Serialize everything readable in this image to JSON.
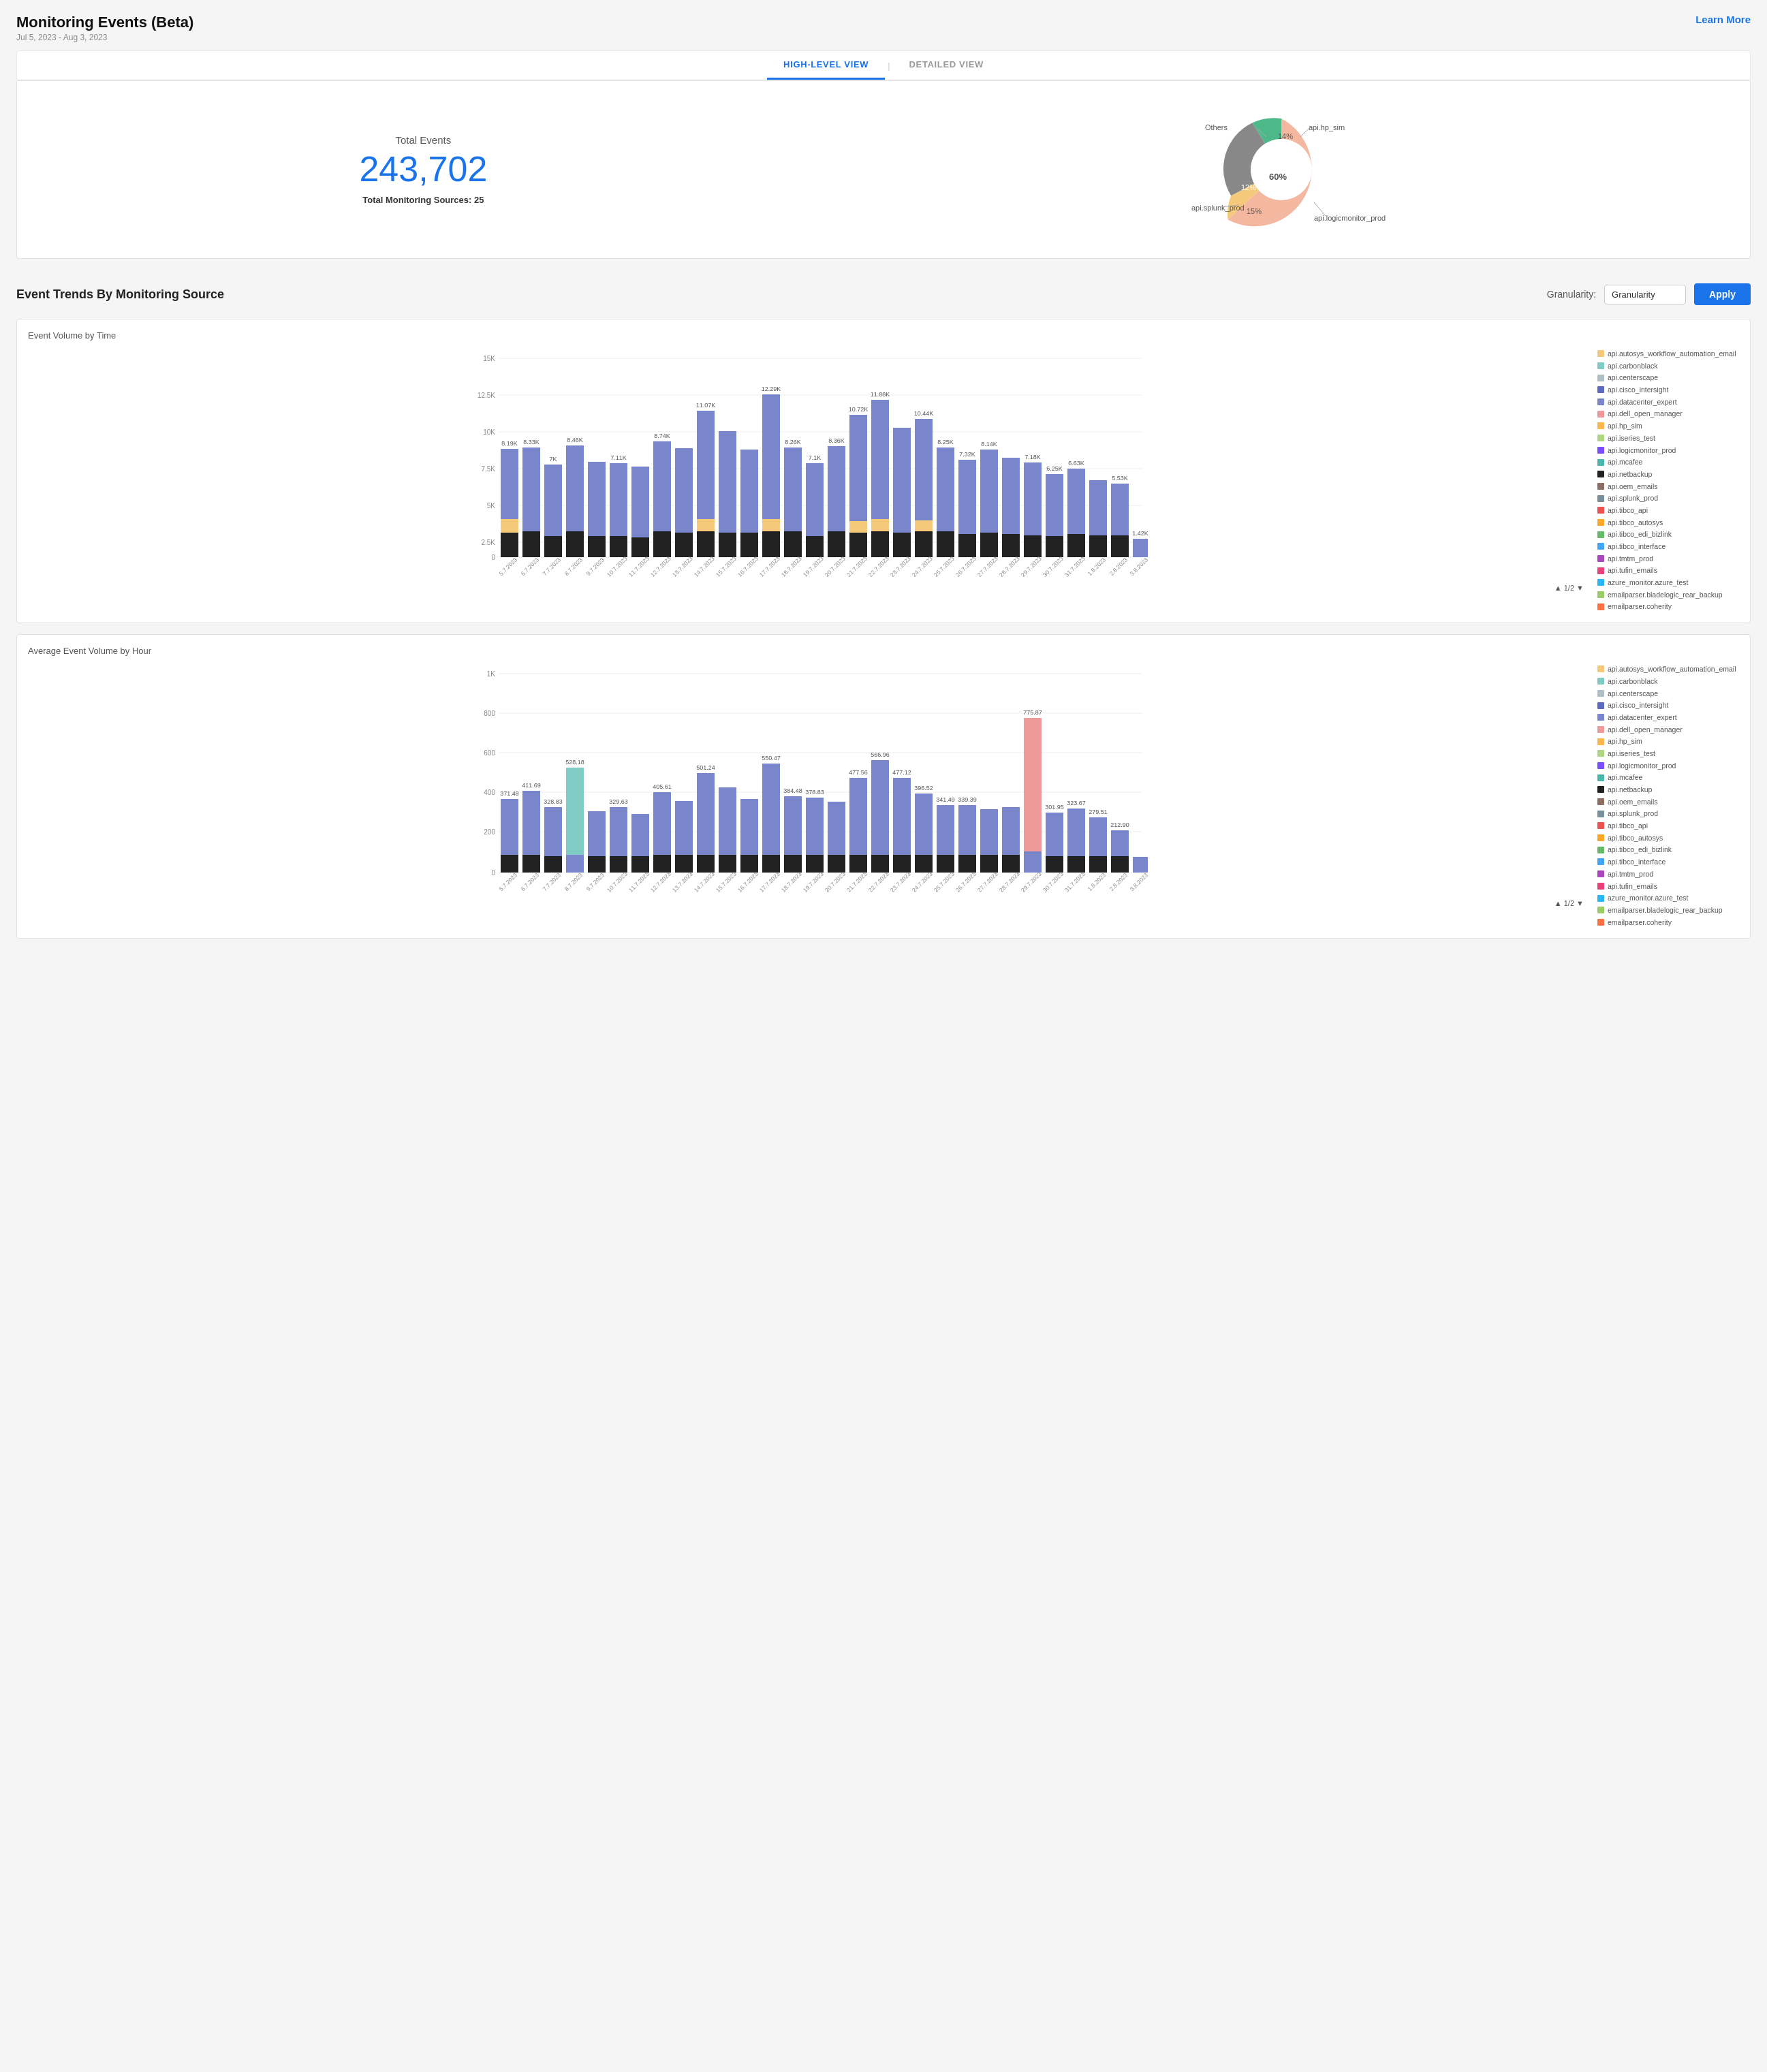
{
  "header": {
    "title": "Monitoring Events (Beta)",
    "date_range": "Jul 5, 2023 - Aug 3, 2023",
    "learn_more": "Learn More"
  },
  "tabs": [
    {
      "label": "HIGH-LEVEL VIEW",
      "active": true
    },
    {
      "label": "DETAILED VIEW",
      "active": false
    }
  ],
  "summary": {
    "total_events_label": "Total Events",
    "total_events_number": "243,702",
    "total_sources_label": "Total Monitoring Sources:",
    "total_sources_value": "25"
  },
  "donut": {
    "segments": [
      {
        "label": "api.logicmonitor_prod",
        "value": 60,
        "color": "#f4b8a0"
      },
      {
        "label": "api.hp_sim",
        "value": 14,
        "color": "#f4c97a"
      },
      {
        "label": "Others",
        "value": 12,
        "color": "#888"
      },
      {
        "label": "api.splunk_prod",
        "value": 15,
        "color": "#4db88a"
      }
    ]
  },
  "trends_section": {
    "title": "Event Trends By Monitoring Source",
    "granularity_label": "Granularity:",
    "granularity_placeholder": "Granularity",
    "apply_label": "Apply"
  },
  "chart1": {
    "title": "Event Volume by Time",
    "y_max": "15K",
    "y_ticks": [
      "15K",
      "12.5K",
      "10K",
      "7.5K",
      "5K",
      "2.5K",
      "0"
    ],
    "bars": [
      {
        "date": "5.7.2023",
        "total": "8.19K",
        "value": 8190
      },
      {
        "date": "6.7.2023",
        "total": "8.33K",
        "value": 8330
      },
      {
        "date": "7.7.2023",
        "total": "7K",
        "value": 7000
      },
      {
        "date": "8.7.2023",
        "total": "8.46K",
        "value": 8460
      },
      {
        "date": "9.7.2023",
        "total": "",
        "value": 7200
      },
      {
        "date": "10.7.2023",
        "total": "7.11K",
        "value": 7110
      },
      {
        "date": "11.7.2023",
        "total": "",
        "value": 6800
      },
      {
        "date": "12.7.2023",
        "total": "8.74K",
        "value": 8740
      },
      {
        "date": "13.7.2023",
        "total": "",
        "value": 8200
      },
      {
        "date": "14.7.2023",
        "total": "11.07K",
        "value": 11070
      },
      {
        "date": "15.7.2023",
        "total": "",
        "value": 9500
      },
      {
        "date": "16.7.2023",
        "total": "",
        "value": 8100
      },
      {
        "date": "17.7.2023",
        "total": "12.29K",
        "value": 12290
      },
      {
        "date": "18.7.2023",
        "total": "8.26K",
        "value": 8260
      },
      {
        "date": "19.7.2023",
        "total": "7.1K",
        "value": 7100
      },
      {
        "date": "20.7.2023",
        "total": "8.36K",
        "value": 8360
      },
      {
        "date": "21.7.2023",
        "total": "10.72K",
        "value": 10720
      },
      {
        "date": "22.7.2023",
        "total": "11.88K",
        "value": 11880
      },
      {
        "date": "23.7.2023",
        "total": "",
        "value": 9800
      },
      {
        "date": "24.7.2023",
        "total": "10.44K",
        "value": 10440
      },
      {
        "date": "25.7.2023",
        "total": "8.25K",
        "value": 8250
      },
      {
        "date": "26.7.2023",
        "total": "7.32K",
        "value": 7320
      },
      {
        "date": "27.7.2023",
        "total": "8.14K",
        "value": 8140
      },
      {
        "date": "28.7.2023",
        "total": "",
        "value": 7500
      },
      {
        "date": "29.7.2023",
        "total": "7.18K",
        "value": 7180
      },
      {
        "date": "30.7.2023",
        "total": "6.25K",
        "value": 6250
      },
      {
        "date": "31.7.2023",
        "total": "6.63K",
        "value": 6630
      },
      {
        "date": "1.8.2023",
        "total": "",
        "value": 5800
      },
      {
        "date": "2.8.2023",
        "total": "5.53K",
        "value": 5530
      },
      {
        "date": "3.8.2023",
        "total": "1.42K",
        "value": 1420
      }
    ],
    "pagination": "▲ 1/2 ▼"
  },
  "chart2": {
    "title": "Average Event Volume by Hour",
    "y_max": "1K",
    "y_ticks": [
      "1K",
      "800",
      "600",
      "400",
      "200",
      "0"
    ],
    "bars": [
      {
        "date": "5.7.2023",
        "total": "371.48",
        "value": 371
      },
      {
        "date": "6.7.2023",
        "total": "411.69",
        "value": 412
      },
      {
        "date": "7.7.2023",
        "total": "328.83",
        "value": 329
      },
      {
        "date": "8.7.2023",
        "total": "528.18",
        "value": 528
      },
      {
        "date": "9.7.2023",
        "total": "",
        "value": 310
      },
      {
        "date": "10.7.2023",
        "total": "329.63",
        "value": 330
      },
      {
        "date": "11.7.2023",
        "total": "",
        "value": 295
      },
      {
        "date": "12.7.2023",
        "total": "405.61",
        "value": 406
      },
      {
        "date": "13.7.2023",
        "total": "",
        "value": 360
      },
      {
        "date": "14.7.2023",
        "total": "501.24",
        "value": 501
      },
      {
        "date": "15.7.2023",
        "total": "",
        "value": 430
      },
      {
        "date": "16.7.2023",
        "total": "",
        "value": 370
      },
      {
        "date": "17.7.2023",
        "total": "550.47",
        "value": 550
      },
      {
        "date": "18.7.2023",
        "total": "384.48",
        "value": 384
      },
      {
        "date": "19.7.2023",
        "total": "378.83",
        "value": 379
      },
      {
        "date": "20.7.2023",
        "total": "",
        "value": 355
      },
      {
        "date": "21.7.2023",
        "total": "477.56",
        "value": 478
      },
      {
        "date": "22.7.2023",
        "total": "566.96",
        "value": 567
      },
      {
        "date": "23.7.2023",
        "total": "477.12",
        "value": 477
      },
      {
        "date": "24.7.2023",
        "total": "396.52",
        "value": 397
      },
      {
        "date": "25.7.2023",
        "total": "341.49",
        "value": 341
      },
      {
        "date": "26.7.2023",
        "total": "339.39",
        "value": 339
      },
      {
        "date": "27.7.2023",
        "total": "",
        "value": 320
      },
      {
        "date": "28.7.2023",
        "total": "",
        "value": 330
      },
      {
        "date": "29.7.2023",
        "total": "775.87",
        "value": 776
      },
      {
        "date": "30.7.2023",
        "total": "301.95",
        "value": 302
      },
      {
        "date": "31.7.2023",
        "total": "323.67",
        "value": 324
      },
      {
        "date": "1.8.2023",
        "total": "279.51",
        "value": 280
      },
      {
        "date": "2.8.2023",
        "total": "212.90",
        "value": 213
      },
      {
        "date": "3.8.2023",
        "total": "",
        "value": 80
      }
    ],
    "pagination": "▲ 1/2 ▼"
  },
  "legend_items": [
    {
      "label": "api.autosys_workflow_automation_email",
      "color": "#f4c97a"
    },
    {
      "label": "api.carbonblack",
      "color": "#80cbc4"
    },
    {
      "label": "api.centerscape",
      "color": "#b0bec5"
    },
    {
      "label": "api.cisco_intersight",
      "color": "#5c6bc0"
    },
    {
      "label": "api.datacenter_expert",
      "color": "#7986cb"
    },
    {
      "label": "api.dell_open_manager",
      "color": "#ef9a9a"
    },
    {
      "label": "api.hp_sim",
      "color": "#ffb74d"
    },
    {
      "label": "api.iseries_test",
      "color": "#aed581"
    },
    {
      "label": "api.logicmonitor_prod",
      "color": "#7c4dff"
    },
    {
      "label": "api.mcafee",
      "color": "#4db6ac"
    },
    {
      "label": "api.netbackup",
      "color": "#212121"
    },
    {
      "label": "api.oem_emails",
      "color": "#8d6e63"
    },
    {
      "label": "api.splunk_prod",
      "color": "#78909c"
    },
    {
      "label": "api.tibco_api",
      "color": "#ef5350"
    },
    {
      "label": "api.tibco_autosys",
      "color": "#ffa726"
    },
    {
      "label": "api.tibco_edi_bizlink",
      "color": "#66bb6a"
    },
    {
      "label": "api.tibco_interface",
      "color": "#42a5f5"
    },
    {
      "label": "api.tmtm_prod",
      "color": "#ab47bc"
    },
    {
      "label": "api.tufin_emails",
      "color": "#ec407a"
    },
    {
      "label": "azure_monitor.azure_test",
      "color": "#29b6f6"
    },
    {
      "label": "emailparser.bladelogic_rear_backup",
      "color": "#9ccc65"
    },
    {
      "label": "emailparser.coherity",
      "color": "#ff7043"
    }
  ]
}
